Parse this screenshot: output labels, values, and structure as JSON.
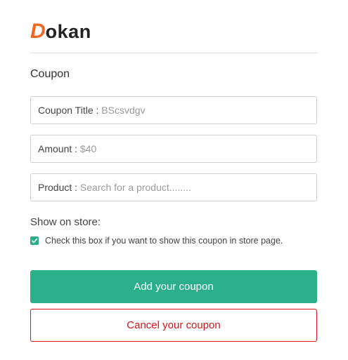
{
  "brand": {
    "logo_first_letter": "D",
    "logo_rest": "okan",
    "accent_color": "#f26522"
  },
  "form": {
    "section_title": "Coupon",
    "fields": [
      {
        "label": "Coupon Title : ",
        "value": "BScsvdgv"
      },
      {
        "label": "Amount : ",
        "value": "$40"
      },
      {
        "label": "Product : ",
        "value": "Search for a product........"
      }
    ],
    "show_on_store_label": "Show on store:",
    "checkbox": {
      "checked": true,
      "text": "Check this box if you want to show this coupon in store page."
    },
    "add_button_label": "Add your coupon",
    "cancel_button_label": "Cancel your coupon"
  },
  "colors": {
    "primary": "#2bb08a",
    "danger": "#d9141a"
  },
  "icons": {
    "checkbox": "check-icon"
  }
}
